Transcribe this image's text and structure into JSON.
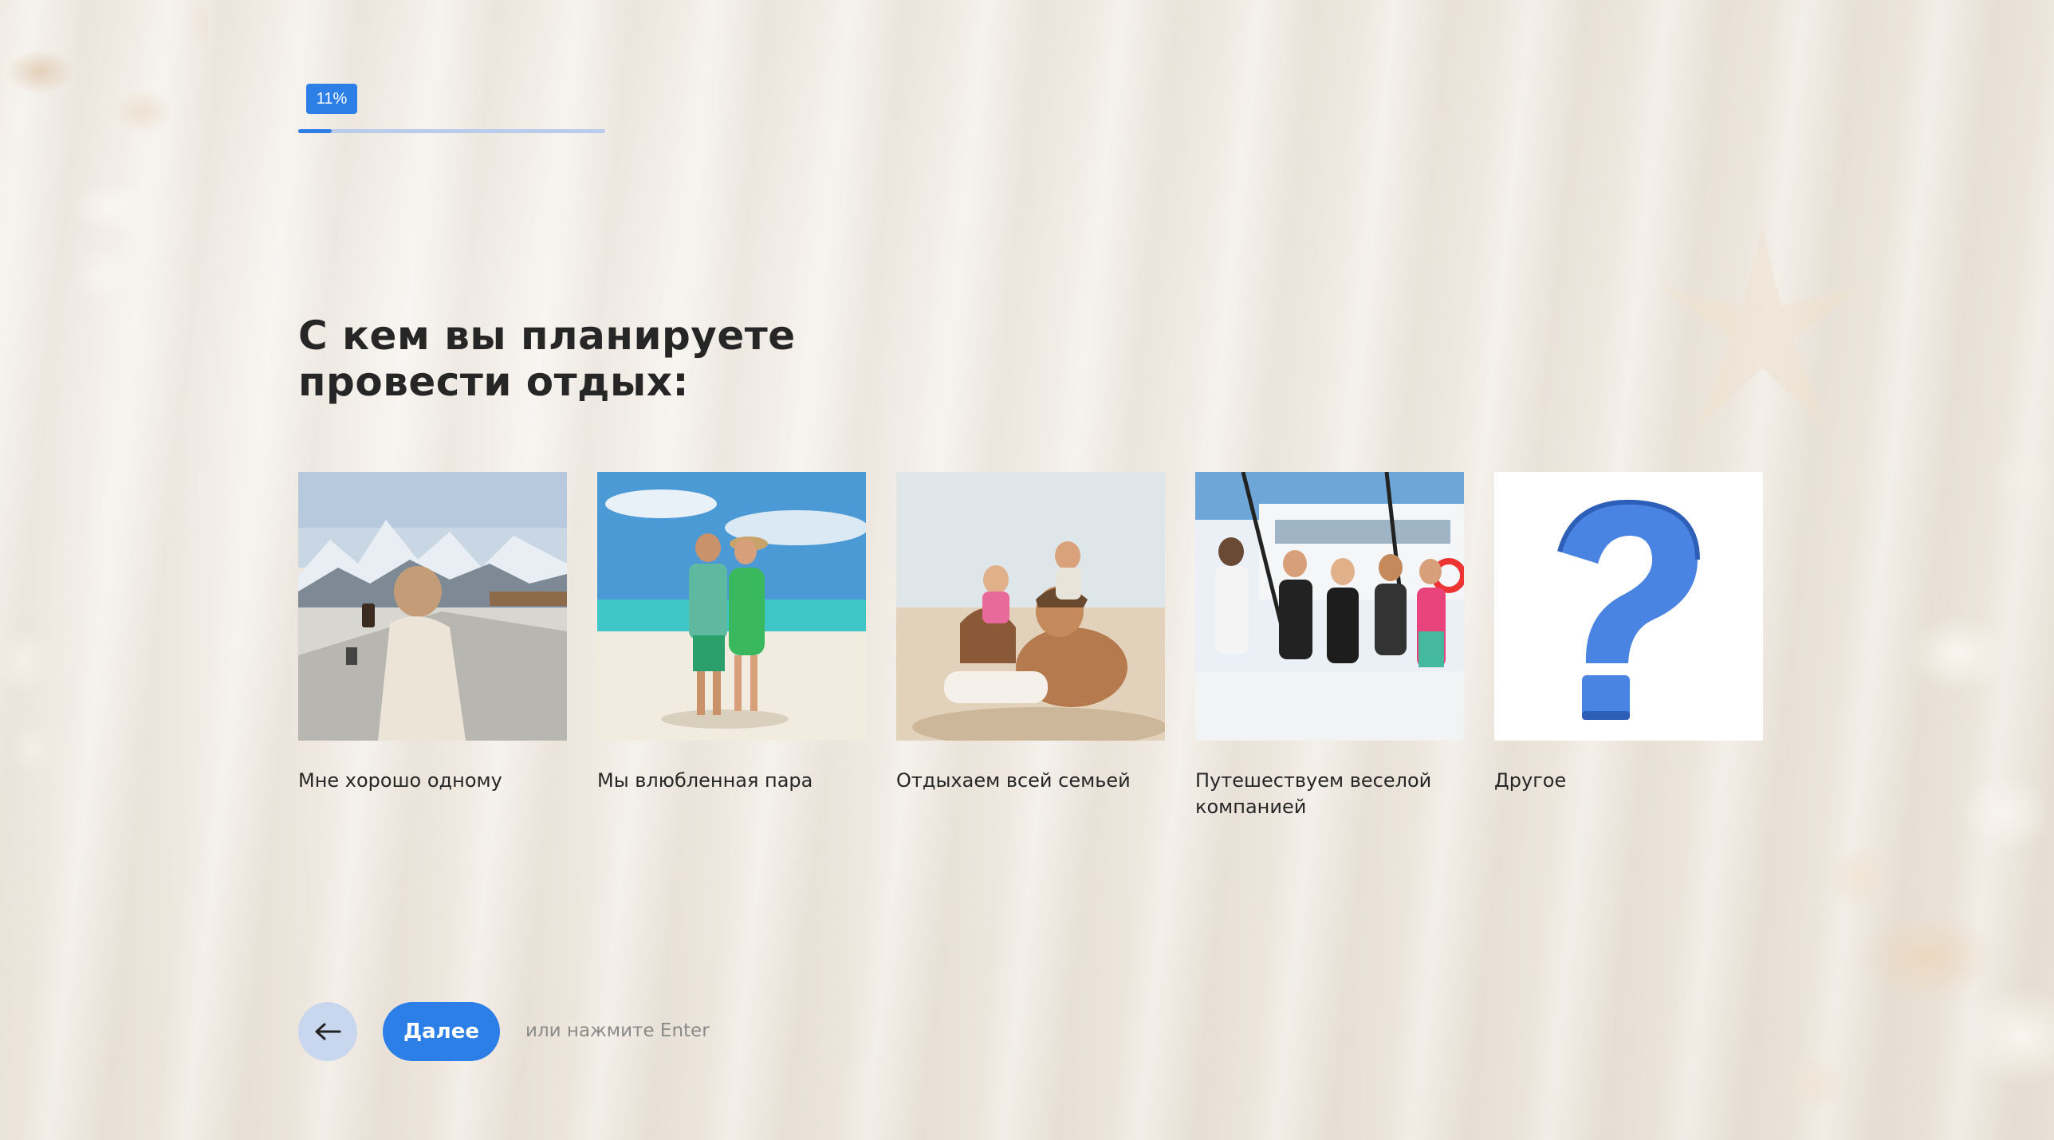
{
  "progress": {
    "label": "11%",
    "percent": 11
  },
  "question": {
    "title": "С кем вы планируете провести отдых:"
  },
  "options": [
    {
      "label": "Мне хорошо одному",
      "image": "woman-alone-mountains-photo"
    },
    {
      "label": "Мы влюбленная пара",
      "image": "couple-on-beach-photo"
    },
    {
      "label": "Отдыхаем всей семьей",
      "image": "family-on-beach-photo"
    },
    {
      "label": "Путешествуем веселой компанией",
      "image": "friends-on-yacht-photo"
    },
    {
      "label": "Другое",
      "image": "question-mark-icon"
    }
  ],
  "nav": {
    "back_icon": "arrow-left-icon",
    "next_label": "Далее",
    "hint": "или нажмите Enter"
  },
  "colors": {
    "accent": "#2d7fe8",
    "back_button": "#c8d6ee",
    "progress_track": "#b9ccec",
    "text": "#262626"
  }
}
